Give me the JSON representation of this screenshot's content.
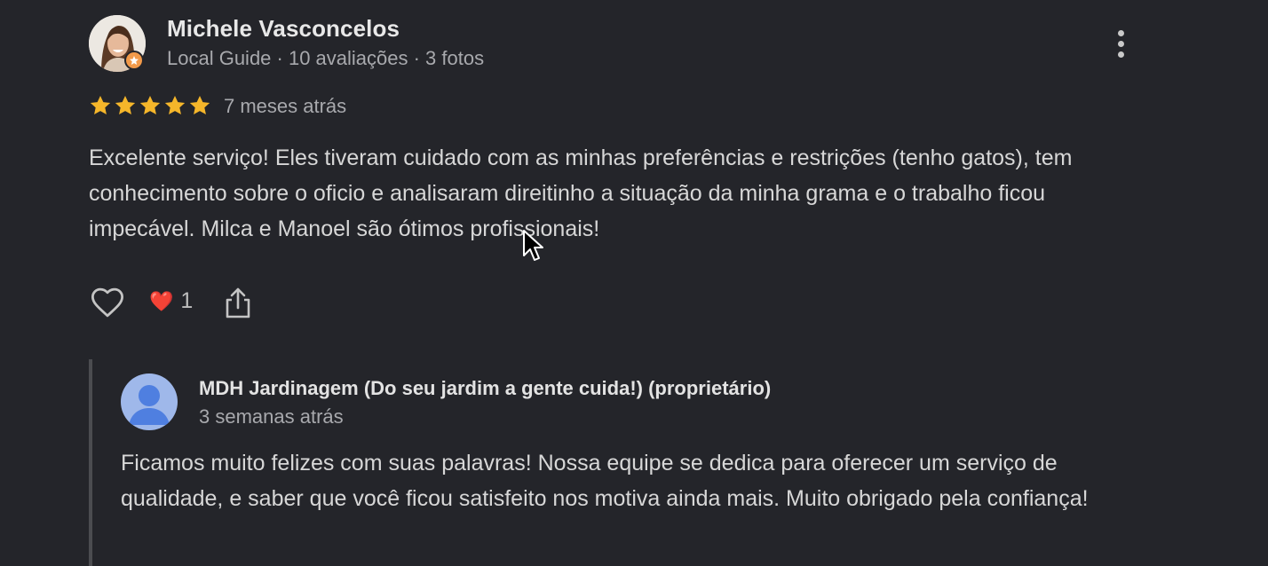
{
  "review": {
    "reviewer_name": "Michele Vasconcelos",
    "reviewer_meta": "Local Guide · 10 avaliações · 3 fotos",
    "rating": 5,
    "rating_max": 5,
    "date": "7 meses atrás",
    "text": "Excelente serviço! Eles tiveram cuidado com as minhas preferências e restrições (tenho gatos), tem conhecimento sobre o oficio e analisaram direitinho a situação da minha grama e o trabalho ficou impecável. Milca e Manoel são ótimos profissionais!",
    "reaction_emoji": "❤️",
    "reaction_count": "1",
    "icons": {
      "more": "more-vert-icon",
      "like": "heart-outline-icon",
      "share": "share-icon",
      "badge": "local-guide-star-icon"
    }
  },
  "owner_reply": {
    "name": "MDH Jardinagem (Do seu jardim a gente cuida!) (proprietário)",
    "date": "3 semanas atrás",
    "text": "Ficamos muito felizes com suas palavras! Nossa equipe se dedica para oferecer um serviço de qualidade, e saber que você ficou satisfeito nos motiva ainda mais. Muito obrigado pela confiança!",
    "avatar_icon": "default-user-icon"
  },
  "colors": {
    "background": "#24252a",
    "star": "#f5b62a",
    "badge": "#f29a4a",
    "owner_avatar": "#9fb8ea"
  }
}
